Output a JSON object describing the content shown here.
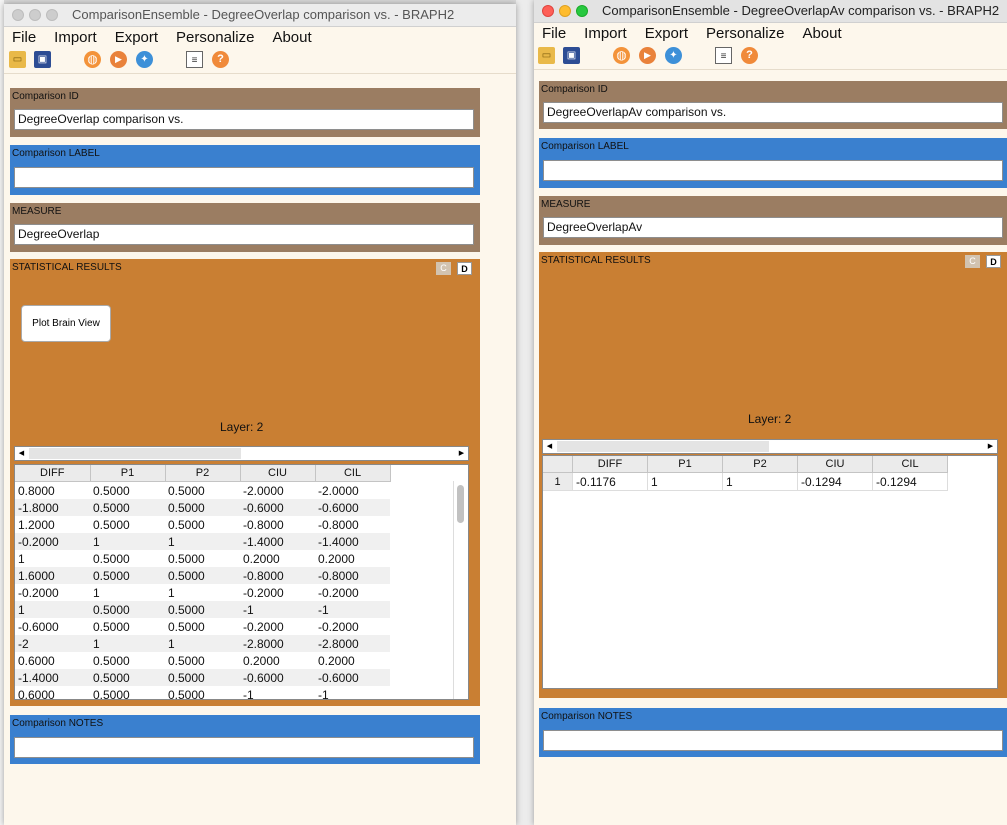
{
  "window1": {
    "title": "ComparisonEnsemble - DegreeOverlap comparison  vs.  - BRAPH2",
    "menu": [
      "File",
      "Import",
      "Export",
      "Personalize",
      "About"
    ],
    "comparison_id_label": "Comparison ID",
    "comparison_id_value": "DegreeOverlap comparison  vs.",
    "comparison_label_label": "Comparison LABEL",
    "comparison_label_value": "",
    "measure_label": "MEASURE",
    "measure_value": "DegreeOverlap",
    "stat_label": "STATISTICAL RESULTS",
    "c_button": "C",
    "d_button": "D",
    "plot_button": "Plot Brain View",
    "layer_text": "Layer: 2",
    "columns": [
      "DIFF",
      "P1",
      "P2",
      "CIU",
      "CIL"
    ],
    "rows": [
      [
        "0.8000",
        "0.5000",
        "0.5000",
        "-2.0000",
        "-2.0000"
      ],
      [
        "-1.8000",
        "0.5000",
        "0.5000",
        "-0.6000",
        "-0.6000"
      ],
      [
        "1.2000",
        "0.5000",
        "0.5000",
        "-0.8000",
        "-0.8000"
      ],
      [
        "-0.2000",
        "1",
        "1",
        "-1.4000",
        "-1.4000"
      ],
      [
        "1",
        "0.5000",
        "0.5000",
        "0.2000",
        "0.2000"
      ],
      [
        "1.6000",
        "0.5000",
        "0.5000",
        "-0.8000",
        "-0.8000"
      ],
      [
        "-0.2000",
        "1",
        "1",
        "-0.2000",
        "-0.2000"
      ],
      [
        "1",
        "0.5000",
        "0.5000",
        "-1",
        "-1"
      ],
      [
        "-0.6000",
        "0.5000",
        "0.5000",
        "-0.2000",
        "-0.2000"
      ],
      [
        "-2",
        "1",
        "1",
        "-2.8000",
        "-2.8000"
      ],
      [
        "0.6000",
        "0.5000",
        "0.5000",
        "0.2000",
        "0.2000"
      ],
      [
        "-1.4000",
        "0.5000",
        "0.5000",
        "-0.6000",
        "-0.6000"
      ],
      [
        "0.6000",
        "0.5000",
        "0.5000",
        "-1",
        "-1"
      ]
    ],
    "notes_label": "Comparison NOTES",
    "notes_value": ""
  },
  "window2": {
    "title": "ComparisonEnsemble - DegreeOverlapAv comparison  vs.  - BRAPH2",
    "menu": [
      "File",
      "Import",
      "Export",
      "Personalize",
      "About"
    ],
    "comparison_id_label": "Comparison ID",
    "comparison_id_value": "DegreeOverlapAv comparison  vs.",
    "comparison_label_label": "Comparison LABEL",
    "comparison_label_value": "",
    "measure_label": "MEASURE",
    "measure_value": "DegreeOverlapAv",
    "stat_label": "STATISTICAL RESULTS",
    "c_button": "C",
    "d_button": "D",
    "layer_text": "Layer: 2",
    "columns": [
      "DIFF",
      "P1",
      "P2",
      "CIU",
      "CIL"
    ],
    "row_headers": [
      "1"
    ],
    "rows": [
      [
        "-0.1176",
        "1",
        "1",
        "-0.1294",
        "-0.1294"
      ]
    ],
    "notes_label": "Comparison NOTES",
    "notes_value": ""
  },
  "toolbar_icons": [
    "open-icon",
    "save-icon",
    "website-icon",
    "youtube-icon",
    "twitter-icon",
    "report-icon",
    "help-icon"
  ]
}
